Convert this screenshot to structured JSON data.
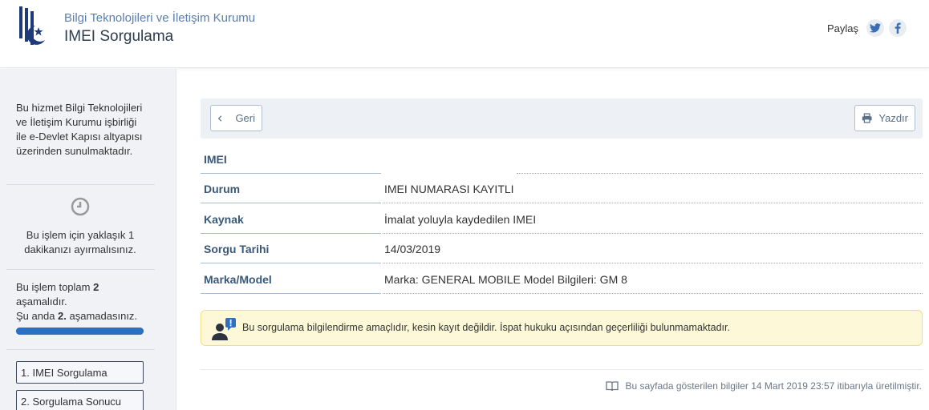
{
  "header": {
    "org_name": "Bilgi Teknolojileri ve İletişim Kurumu",
    "page_title": "IMEI Sorgulama",
    "share_label": "Paylaş",
    "share_icons": [
      "twitter-icon",
      "facebook-icon"
    ]
  },
  "sidebar": {
    "intro": "Bu hizmet Bilgi Teknolojileri ve İletişim Kurumu işbirliği ile e-Devlet Kapısı altyapısı üzerinden sunulmaktadır.",
    "time_icon": "clock-icon",
    "time_text": "Bu işlem için yaklaşık 1 dakikanızı ayırmalısınız.",
    "steps_text_1": "Bu işlem toplam ",
    "steps_total": "2",
    "steps_text_2": " aşamalıdır.",
    "steps_text_3": "Şu anda ",
    "steps_current": "2.",
    "steps_text_4": " aşamadasınız.",
    "progress": 1.0,
    "steps": [
      "1. IMEI Sorgulama",
      "2. Sorgulama Sonucu"
    ]
  },
  "toolbar": {
    "back_label": "Geri",
    "print_label": "Yazdır"
  },
  "result": {
    "rows": [
      {
        "label": "IMEI",
        "value": ""
      },
      {
        "label": "Durum",
        "value": "IMEI NUMARASI KAYITLI"
      },
      {
        "label": "Kaynak",
        "value": "İmalat yoluyla kaydedilen IMEI"
      },
      {
        "label": "Sorgu Tarihi",
        "value": "14/03/2019"
      },
      {
        "label": "Marka/Model",
        "value": "Marka: GENERAL MOBILE Model Bilgileri: GM 8"
      }
    ]
  },
  "notice": {
    "text": "Bu sorgulama bilgilendirme amaçlıdır, kesin kayıt değildir. İspat hukuku açısından geçerliliği bulunmamaktadır."
  },
  "footer": {
    "note": "Bu sayfada gösterilen bilgiler 14 Mart 2019 23:57 itibarıyla üretilmiştir."
  },
  "colors": {
    "accent": "#2e70c0",
    "label": "#3a5878",
    "notice_bg": "#fdf9d8",
    "notice_border": "#f1dd83"
  }
}
